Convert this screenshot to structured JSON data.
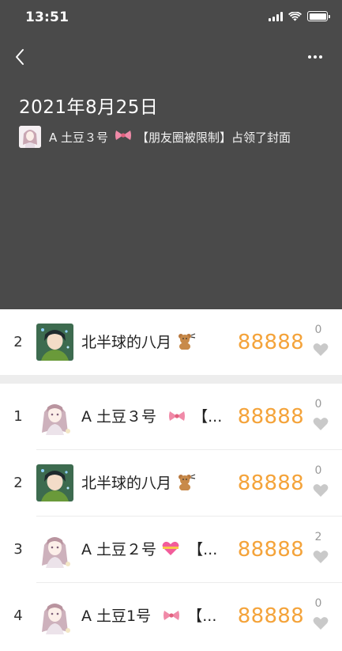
{
  "status_bar": {
    "time": "13:51"
  },
  "header": {
    "date_title": "2021年8月25日",
    "cover_name": "A 土豆３号",
    "cover_tag": "【朋友圈被限制】",
    "cover_suffix": "占领了封面"
  },
  "my_entry": {
    "rank": "2",
    "name": "北半球的八月",
    "steps": "88888",
    "likes": "0"
  },
  "ranking": [
    {
      "rank": "1",
      "name": "A 土豆３号",
      "suffix": "【...",
      "steps": "88888",
      "likes": "0",
      "avatar": "anime-girl",
      "badge": "ribbon"
    },
    {
      "rank": "2",
      "name": "北半球的八月",
      "suffix": "",
      "steps": "88888",
      "likes": "0",
      "avatar": "anime-boy",
      "badge": "bear"
    },
    {
      "rank": "3",
      "name": "A 土豆２号",
      "suffix": "【...",
      "steps": "88888",
      "likes": "2",
      "avatar": "anime-girl",
      "badge": "heart"
    },
    {
      "rank": "4",
      "name": "A 土豆1号",
      "suffix": "【...",
      "steps": "88888",
      "likes": "0",
      "avatar": "anime-girl",
      "badge": "ribbon"
    }
  ],
  "colors": {
    "header_bg": "#4a4a4a",
    "steps": "#f4a33a",
    "heart": "#c9c9c9"
  }
}
